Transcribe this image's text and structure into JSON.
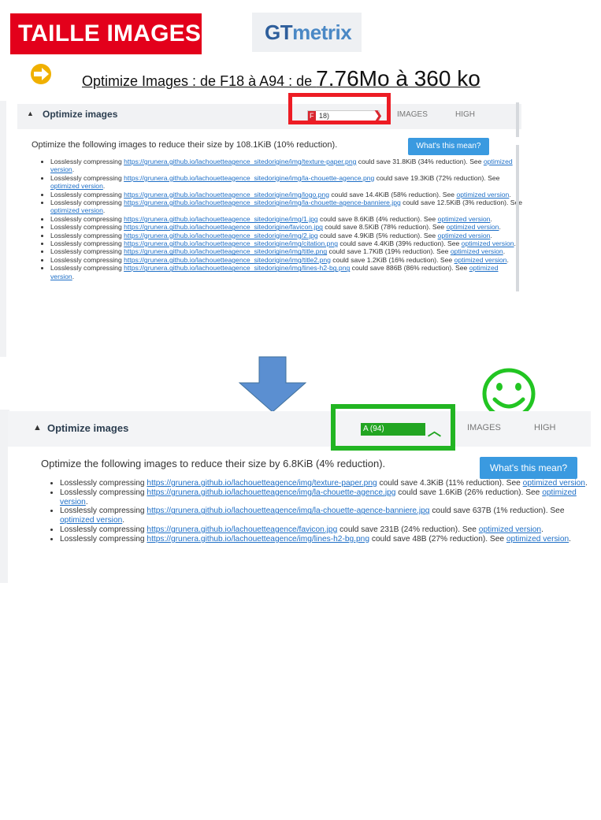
{
  "slide": {
    "badge_text": "TAILLE IMAGES",
    "logo_gt": "GT",
    "logo_metrix": "metrix",
    "subtitle_part1": "Optimize Images : de F18 à A94 : de ",
    "subtitle_part2": "7.76Mo à 360 ko",
    "colors": {
      "badge": "#e3001b",
      "highlight_red": "#ed1c24",
      "highlight_green": "#22b522",
      "arrow": "#5b8fd1"
    },
    "icons": [
      "arrow-right-circle-icon",
      "arrow-down-icon",
      "smiley-icon"
    ]
  },
  "before": {
    "section_title": "Optimize images",
    "grade_letter": "F",
    "grade_score": "18)",
    "grade_fill_fraction": 0.18,
    "type": "IMAGES",
    "priority": "HIGH",
    "intro": "Optimize the following images to reduce their size by 108.1KiB (10% reduction).",
    "button": "What's this mean?",
    "items": [
      {
        "pre": "Losslessly compressing ",
        "url": "https://grunera.github.io/lachouetteagence_sitedorigine/img/texture-paper.png",
        "post": " could save 31.8KiB (34% reduction). See ",
        "link": "optimized version",
        "end": "."
      },
      {
        "pre": "Losslessly compressing ",
        "url": "https://grunera.github.io/lachouetteagence_sitedorigine/img/la-chouette-agence.png",
        "post": " could save 19.3KiB (72% reduction). See ",
        "link": "optimized version",
        "end": "."
      },
      {
        "pre": "Losslessly compressing ",
        "url": "https://grunera.github.io/lachouetteagence_sitedorigine/img/logo.png",
        "post": " could save 14.4KiB (58% reduction). See ",
        "link": "optimized version",
        "end": "."
      },
      {
        "pre": "Losslessly compressing ",
        "url": "https://grunera.github.io/lachouetteagence_sitedorigine/img/la-chouette-agence-banniere.jpg",
        "post": " could save 12.5KiB (3% reduction). See ",
        "link": "optimized version",
        "end": "."
      },
      {
        "pre": "Losslessly compressing ",
        "url": "https://grunera.github.io/lachouetteagence_sitedorigine/img/1.jpg",
        "post": " could save 8.6KiB (4% reduction). See ",
        "link": "optimized version",
        "end": "."
      },
      {
        "pre": "Losslessly compressing ",
        "url": "https://grunera.github.io/lachouetteagence_sitedorigine/favicon.jpg",
        "post": " could save 8.5KiB (78% reduction). See ",
        "link": "optimized version",
        "end": "."
      },
      {
        "pre": "Losslessly compressing ",
        "url": "https://grunera.github.io/lachouetteagence_sitedorigine/img/2.jpg",
        "post": " could save 4.9KiB (5% reduction). See ",
        "link": "optimized version",
        "end": "."
      },
      {
        "pre": "Losslessly compressing ",
        "url": "https://grunera.github.io/lachouetteagence_sitedorigine/img/citation.png",
        "post": " could save 4.4KiB (39% reduction). See ",
        "link": "optimized version",
        "end": "."
      },
      {
        "pre": "Losslessly compressing ",
        "url": "https://grunera.github.io/lachouetteagence_sitedorigine/img/title.png",
        "post": " could save 1.7KiB (19% reduction). See ",
        "link": "optimized version",
        "end": "."
      },
      {
        "pre": "Losslessly compressing ",
        "url": "https://grunera.github.io/lachouetteagence_sitedorigine/img/title2.png",
        "post": " could save 1.2KiB (16% reduction). See ",
        "link": "optimized version",
        "end": "."
      },
      {
        "pre": "Losslessly compressing ",
        "url": "https://grunera.github.io/lachouetteagence_sitedorigine/img/lines-h2-bg.png",
        "post": " could save 886B (86% reduction). See ",
        "link": "optimized version",
        "end": "."
      }
    ]
  },
  "after": {
    "section_title": "Optimize images",
    "grade": "A (94)",
    "type": "IMAGES",
    "priority": "HIGH",
    "intro": "Optimize the following images to reduce their size by 6.8KiB (4% reduction).",
    "button": "What's this mean?",
    "items": [
      {
        "pre": "Losslessly compressing ",
        "url": "https://grunera.github.io/lachouetteagence/img/texture-paper.png",
        "post": " could save 4.3KiB (11% reduction). See ",
        "link": "optimized version",
        "end": "."
      },
      {
        "pre": "Losslessly compressing ",
        "url": "https://grunera.github.io/lachouetteagence/img/la-chouette-agence.jpg",
        "post": " could save 1.6KiB (26% reduction). See ",
        "link": "optimized version",
        "end": "."
      },
      {
        "pre": "Losslessly compressing ",
        "url": "https://grunera.github.io/lachouetteagence/img/la-chouette-agence-banniere.jpg",
        "post": " could save 637B (1% reduction). See ",
        "link": "optimized version",
        "end": "."
      },
      {
        "pre": "Losslessly compressing ",
        "url": "https://grunera.github.io/lachouetteagence/favicon.jpg",
        "post": " could save 231B (24% reduction). See ",
        "link": "optimized version",
        "end": "."
      },
      {
        "pre": "Losslessly compressing ",
        "url": "https://grunera.github.io/lachouetteagence/img/lines-h2-bg.png",
        "post": " could save 48B (27% reduction). See ",
        "link": "optimized version",
        "end": "."
      }
    ]
  }
}
